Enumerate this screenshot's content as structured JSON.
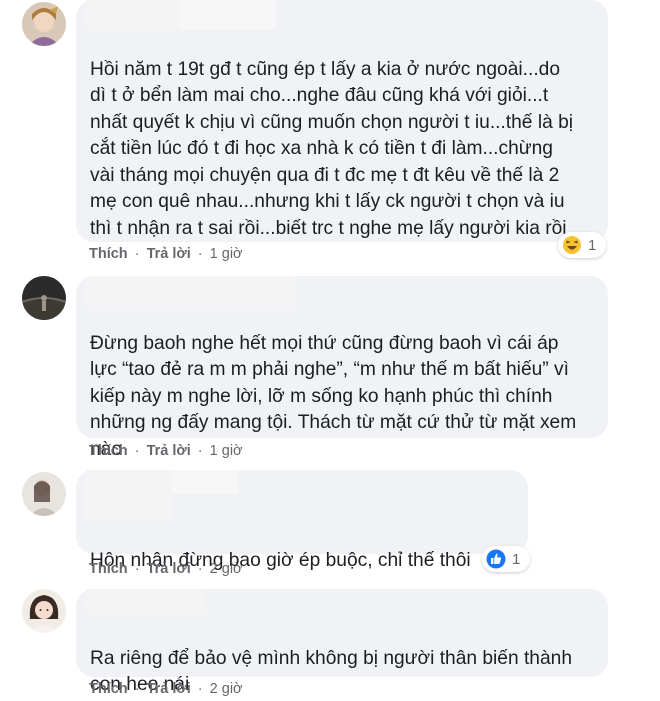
{
  "comments": [
    {
      "text": "Hồi năm t 19t gđ t cũng ép t lấy a kia ở nước ngoài...do\ndì t ở bển làm mai cho...nghe đâu cũng khá với giỏi...t\nnhất quyết k chịu vì cũng muốn chọn người t iu...thế là bị\ncắt tiền lúc đó t đi học xa nhà k có tiền t đi làm...chừng\nvài tháng mọi chuyện qua đi t đc mẹ t đt kêu về thế là 2\nmẹ con quê nhau...nhưng khi t lấy ck người t chọn và iu\nthì t nhận ra t sai rồi...biết trc t nghe mẹ lấy người kia rồi",
      "emoji": "grinning-sweat-emoji",
      "like_label": "Thích",
      "reply_label": "Trả lời",
      "time": "1 giờ",
      "reaction": {
        "icon": "haha-reaction-icon",
        "count": "1"
      }
    },
    {
      "text": "Đừng baoh nghe hết mọi thứ cũng đừng baoh vì cái áp\nlực “tao đẻ ra m m phải nghe”, “m như thế m bất hiếu” vì\nkiếp này m nghe lời, lỡ m sống ko hạnh phúc thì chính\nnhững ng đấy mang tội. Thách từ mặt cứ thử từ mặt xem\nnào",
      "like_label": "Thích",
      "reply_label": "Trả lời",
      "time": "1 giờ"
    },
    {
      "text": "Hôn nhân đừng bao giờ ép buộc, chỉ thế thôi",
      "emoji": "slight-smile-emoji",
      "like_label": "Thích",
      "reply_label": "Trả lời",
      "time": "2 giờ",
      "reaction": {
        "icon": "like-reaction-icon",
        "count": "1"
      }
    },
    {
      "text": "Ra riêng để bảo vệ mình không bị người thân biến thành\ncon heo nái",
      "like_label": "Thích",
      "reply_label": "Trả lời",
      "time": "2 giờ"
    }
  ],
  "colors": {
    "bubble": "#f0f2f5",
    "meta_text": "#65676b",
    "like_blue": "#1877f2",
    "emoji_yellow": "#f7c331"
  }
}
